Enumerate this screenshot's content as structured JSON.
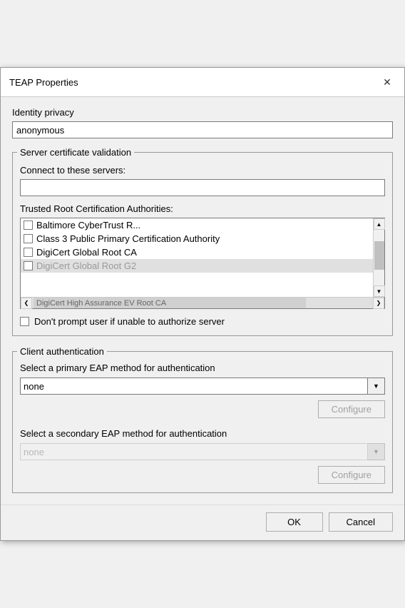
{
  "dialog": {
    "title": "TEAP Properties",
    "close_label": "✕"
  },
  "identity_privacy": {
    "label": "Identity privacy",
    "value": "anonymous"
  },
  "server_cert": {
    "legend": "Server certificate validation",
    "servers_label": "Connect to these servers:",
    "servers_value": "",
    "ca_label": "Trusted Root Certification Authorities:",
    "ca_items": [
      "Baltimore CyberTrust R...",
      "Class 3 Public Primary Certification Authority",
      "DigiCert Global Root CA",
      "DigiCert Global Root G2",
      "DigiCert High Assurance EV Root CA"
    ],
    "dont_prompt_label": "Don't prompt user if unable to authorize server"
  },
  "client_auth": {
    "legend": "Client authentication",
    "primary_label": "Select a primary EAP method for authentication",
    "primary_value": "none",
    "primary_options": [
      "none"
    ],
    "configure_primary_label": "Configure",
    "secondary_label": "Select a secondary EAP method for authentication",
    "secondary_value": "none",
    "secondary_options": [
      "none"
    ],
    "configure_secondary_label": "Configure"
  },
  "buttons": {
    "ok_label": "OK",
    "cancel_label": "Cancel"
  },
  "icons": {
    "close": "✕",
    "chevron_down": "▼",
    "chevron_right": "❯",
    "chevron_left": "❮",
    "chevron_up": "▲"
  }
}
